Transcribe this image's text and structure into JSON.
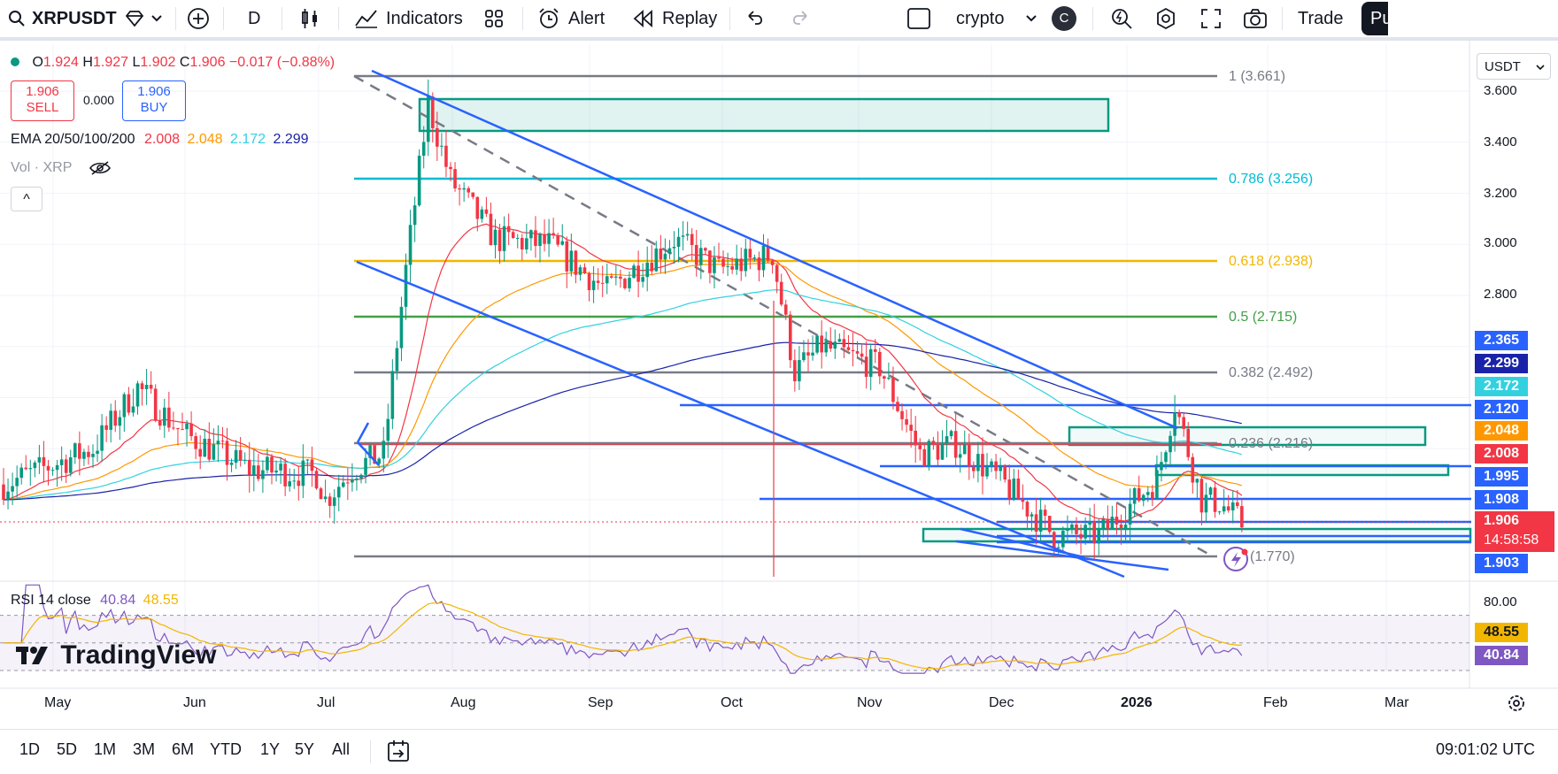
{
  "toolbar": {
    "symbol": "XRPUSDT",
    "interval": "D",
    "indicators_label": "Indicators",
    "alert_label": "Alert",
    "replay_label": "Replay",
    "layout_name": "crypto",
    "avatar_letter": "C",
    "trade_label": "Trade",
    "publish_label": "Pu"
  },
  "legend": {
    "o_label": "O",
    "o_val": "1.924",
    "h_label": "H",
    "h_val": "1.927",
    "l_label": "L",
    "l_val": "1.902",
    "c_label": "C",
    "c_val": "1.906",
    "change": "−0.017 (−0.88%)",
    "sell_price": "1.906",
    "sell_label": "SELL",
    "spread": "0.000",
    "buy_price": "1.906",
    "buy_label": "BUY",
    "ema_label": "EMA 20/50/100/200",
    "ema20": "2.008",
    "ema50": "2.048",
    "ema100": "2.172",
    "ema200": "2.299",
    "vol_label": "Vol · XRP",
    "collapse": "^"
  },
  "currency": "USDT",
  "price_axis": {
    "ticks": [
      "3.600",
      "3.400",
      "3.200",
      "3.000",
      "2.800"
    ],
    "badges": [
      {
        "text": "2.365",
        "color": "#2962ff"
      },
      {
        "text": "2.299",
        "color": "#1a23a8"
      },
      {
        "text": "2.172",
        "color": "#33d1e0"
      },
      {
        "text": "2.120",
        "color": "#2962ff"
      },
      {
        "text": "2.048",
        "color": "#ff9800"
      },
      {
        "text": "2.008",
        "color": "#f23645"
      },
      {
        "text": "1.995",
        "color": "#2962ff"
      },
      {
        "text": "1.908",
        "color": "#2962ff"
      },
      {
        "text": "1.906",
        "color": "#f23645"
      },
      {
        "text": "1.903",
        "color": "#2962ff"
      }
    ],
    "countdown": "14:58:58"
  },
  "fib_levels": [
    {
      "label": "1 (3.661)",
      "color": "#787b86"
    },
    {
      "label": "0.786 (3.256)",
      "color": "#00bcd4"
    },
    {
      "label": "0.618 (2.938)",
      "color": "#f2b600"
    },
    {
      "label": "0.5 (2.715)",
      "color": "#43a047"
    },
    {
      "label": "0.382 (2.492)",
      "color": "#787b86"
    },
    {
      "label": "0.236 (2.216)",
      "color": "#787b86"
    },
    {
      "label": "(1.770)",
      "color": "#787b86"
    }
  ],
  "rsi": {
    "label": "RSI 14 close",
    "value": "40.84",
    "ma": "48.55",
    "level_top": "80.00",
    "badge_ma": "48.55",
    "badge_val": "40.84"
  },
  "watermark": "TradingView",
  "time_axis": [
    "May",
    "Jun",
    "Jul",
    "Aug",
    "Sep",
    "Oct",
    "Nov",
    "Dec",
    "2026",
    "Feb",
    "Mar"
  ],
  "ranges": [
    "1D",
    "5D",
    "1M",
    "3M",
    "6M",
    "YTD",
    "1Y",
    "5Y",
    "All"
  ],
  "clock": "09:01:02 UTC",
  "colors": {
    "up": "#089981",
    "down": "#f23645",
    "accent": "#2962ff"
  }
}
